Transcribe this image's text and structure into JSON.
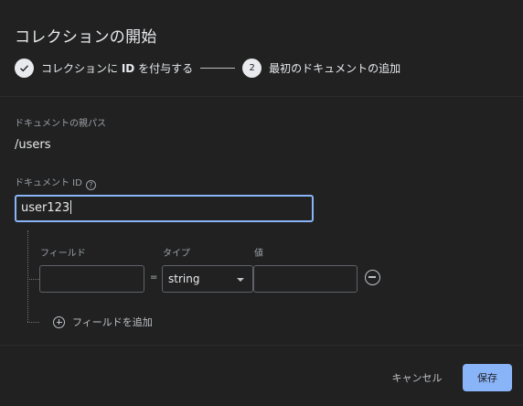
{
  "dialog": {
    "title": "コレクションの開始"
  },
  "stepper": {
    "step1_label_prefix": "コレクションに",
    "step1_label_bold": "ID",
    "step1_label_suffix": "を付与する",
    "step1_icon": "check-icon",
    "step2_number": "2",
    "step2_label": "最初のドキュメントの追加"
  },
  "form": {
    "parent_path_label": "ドキュメントの親パス",
    "parent_path_value": "/users",
    "doc_id_label": "ドキュメント ID",
    "doc_id_help_icon": "?",
    "doc_id_value": "user123"
  },
  "fields": {
    "header_field": "フィールド",
    "header_type": "タイプ",
    "header_value": "値",
    "rows": [
      {
        "field": "",
        "type": "string",
        "value": ""
      }
    ],
    "equals_sign": "=",
    "add_field_label": "フィールドを追加"
  },
  "actions": {
    "cancel_label": "キャンセル",
    "save_label": "保存"
  },
  "colors": {
    "accent": "#8ab4f8",
    "background": "#212121"
  }
}
